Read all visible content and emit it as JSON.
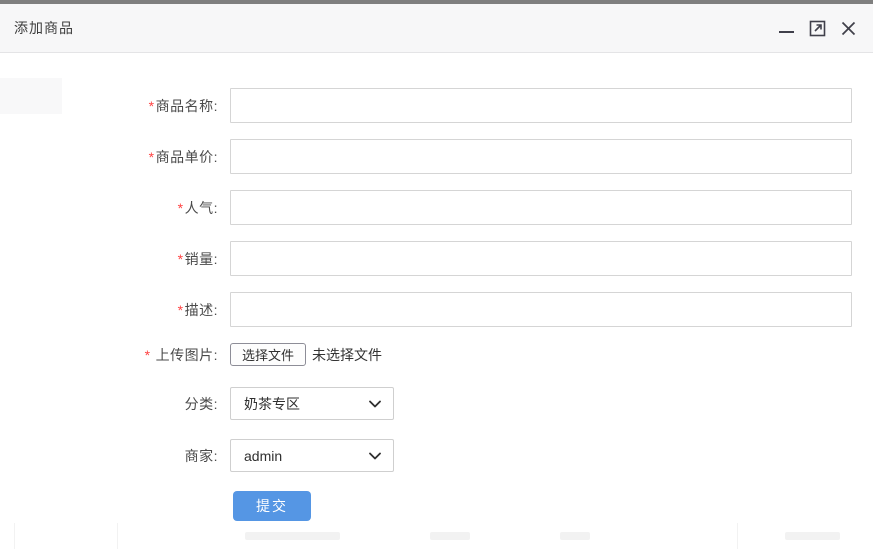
{
  "window": {
    "title": "添加商品",
    "controls": {
      "minimize": "minimize",
      "maximize": "maximize",
      "close": "close"
    }
  },
  "form": {
    "required_mark": "*",
    "fields": {
      "name": {
        "label": "商品名称:",
        "required": true,
        "value": ""
      },
      "price": {
        "label": "商品单价:",
        "required": true,
        "value": ""
      },
      "popularity": {
        "label": "人气:",
        "required": true,
        "value": ""
      },
      "sales": {
        "label": "销量:",
        "required": true,
        "value": ""
      },
      "desc": {
        "label": "描述:",
        "required": true,
        "value": ""
      },
      "image": {
        "label": "上传图片:",
        "required": true,
        "button_label": "选择文件",
        "status": "未选择文件"
      },
      "category": {
        "label": "分类:",
        "required": false,
        "value": "奶茶专区"
      },
      "merchant": {
        "label": "商家:",
        "required": false,
        "value": "admin"
      }
    },
    "submit_label": "提交"
  },
  "colors": {
    "accent": "#5596e4",
    "required": "#ff4343",
    "header_bg": "#f7f7f8",
    "topbar": "#7f7f7f",
    "input_border": "#d5d5d5"
  }
}
